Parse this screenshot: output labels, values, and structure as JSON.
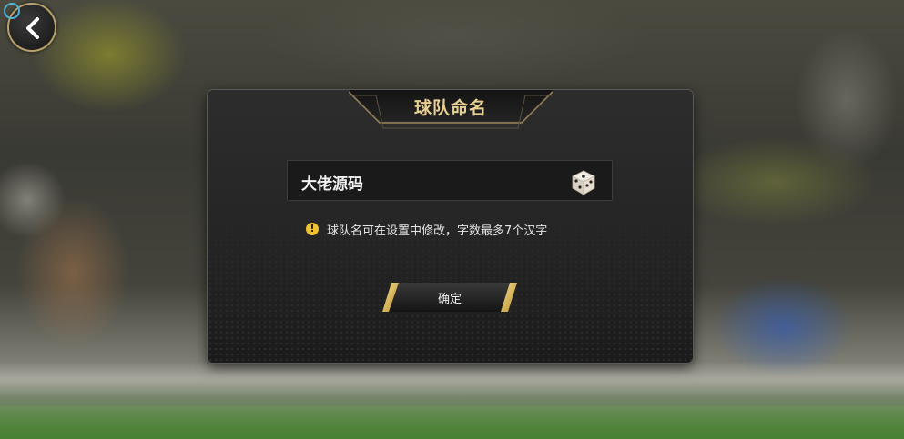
{
  "dialog": {
    "title": "球队命名",
    "team_name_value": "大佬源码",
    "hint": "球队名可在设置中修改，字数最多7个汉字",
    "confirm_label": "确定"
  },
  "icons": {
    "back": "chevron-left-icon",
    "random": "dice-icon",
    "warning": "warning-icon"
  },
  "colors": {
    "accent_gold": "#e8cf94",
    "warning_yellow": "#f0c232",
    "dialog_bg": "#1d1d1d"
  }
}
